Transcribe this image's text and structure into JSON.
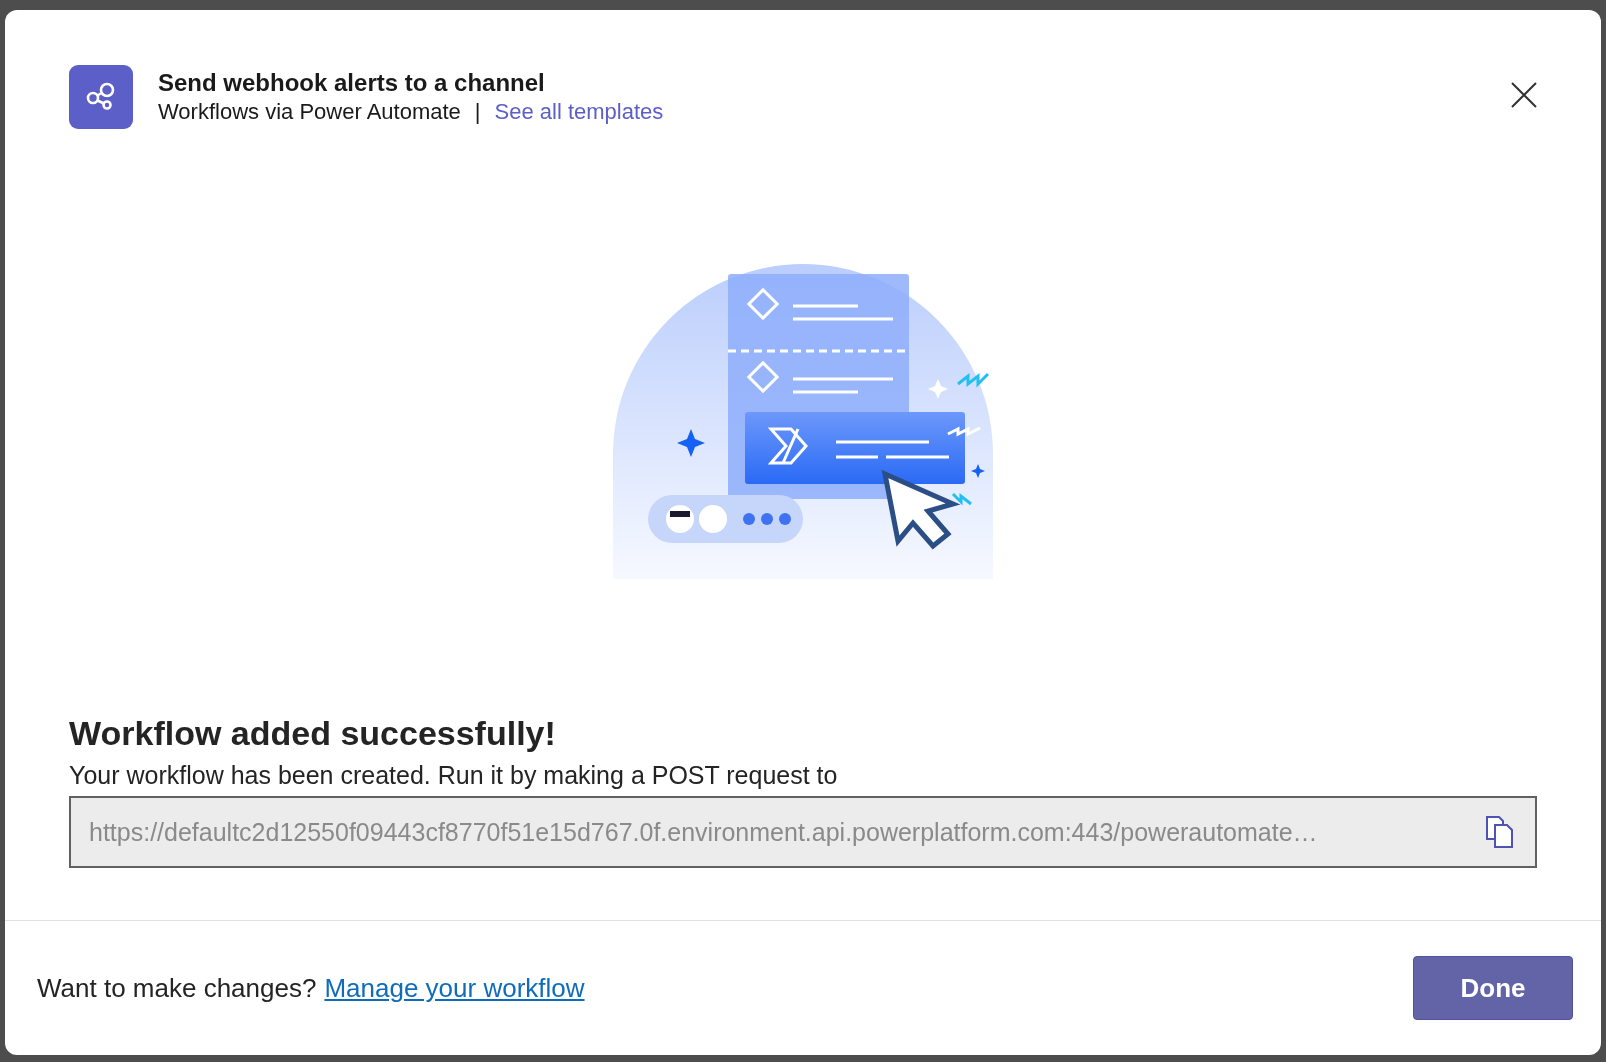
{
  "dialog": {
    "title": "Send webhook alerts to a channel",
    "subtitle": "Workflows via Power Automate",
    "separator": "|",
    "templates_link": "See all templates"
  },
  "result": {
    "heading": "Workflow added successfully!",
    "message": "Your workflow has been created. Run it by making a POST request to",
    "url": "https://defaultc2d12550f09443cf8770f51e15d767.0f.environment.api.powerplatform.com:443/powerautomate…"
  },
  "footer": {
    "prompt": "Want to make changes?",
    "link": "Manage your workflow",
    "buttons": [
      "Done"
    ]
  }
}
